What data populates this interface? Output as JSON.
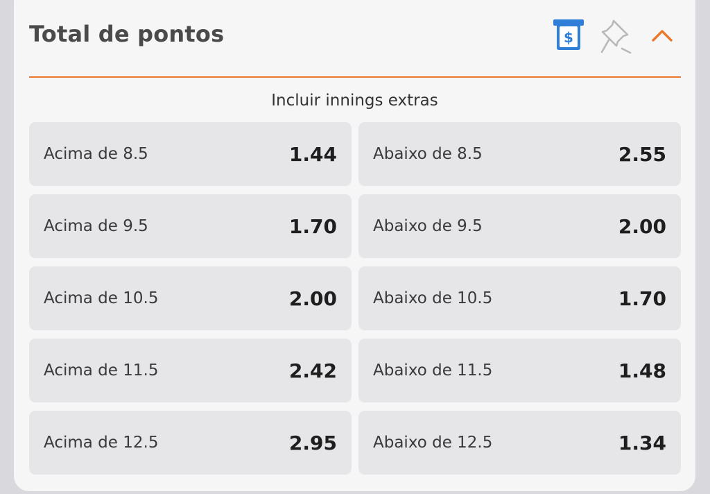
{
  "market": {
    "title": "Total de pontos",
    "subtitle": "Incluir innings extras",
    "icons": [
      "cashout-icon",
      "pin-icon",
      "chevron-up-icon"
    ],
    "accent_color": "#e9782d",
    "cashout_color": "#2f7fd8"
  },
  "rows": [
    {
      "over_label": "Acima de 8.5",
      "over_odds": "1.44",
      "under_label": "Abaixo de 8.5",
      "under_odds": "2.55"
    },
    {
      "over_label": "Acima de 9.5",
      "over_odds": "1.70",
      "under_label": "Abaixo de 9.5",
      "under_odds": "2.00"
    },
    {
      "over_label": "Acima de 10.5",
      "over_odds": "2.00",
      "under_label": "Abaixo de 10.5",
      "under_odds": "1.70"
    },
    {
      "over_label": "Acima de 11.5",
      "over_odds": "2.42",
      "under_label": "Abaixo de 11.5",
      "under_odds": "1.48"
    },
    {
      "over_label": "Acima de 12.5",
      "over_odds": "2.95",
      "under_label": "Abaixo de 12.5",
      "under_odds": "1.34"
    }
  ]
}
